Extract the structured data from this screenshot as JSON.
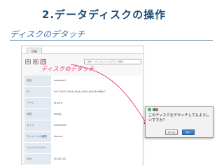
{
  "slide": {
    "title": "2.データディスクの操作",
    "subtitle": "ディスクのデタッチ"
  },
  "panel": {
    "tab_label": "詳細",
    "toolbar": {
      "action_select_text": "操作・ステップレスバックアップ操作",
      "buttons": [
        {
          "icon": "attach-icon",
          "glyph": "⊞"
        },
        {
          "icon": "snapshot-icon",
          "glyph": "▤"
        },
        {
          "icon": "detach-icon",
          "glyph": "⊟"
        }
      ]
    },
    "callout": "ディスクのデタッチ",
    "rows": [
      {
        "label": "名前",
        "value": "datadisk1"
      },
      {
        "label": "ID",
        "value": "ec013c50-20a6-45ab-a054-8b5f40a88b7"
      },
      {
        "label": "ゾーン",
        "value": "jp-w1a"
      },
      {
        "label": "状態",
        "value": "Ready"
      },
      {
        "label": "タイプ",
        "value": "DATADISK"
      },
      {
        "label": "ストレージの種類",
        "value": "shared"
      },
      {
        "label": "ハイパーバイザー",
        "value": ""
      },
      {
        "label": "Size",
        "value": "40.00 GB"
      }
    ]
  },
  "dialog": {
    "title": "確認",
    "message": "このディスクをデタッチしてもよろしいですか?",
    "no_label": "いいえ",
    "yes_label": "はい"
  },
  "colors": {
    "title": "#1f4e79",
    "accent": "#e0206a",
    "label_bg": "#e3e9f1",
    "primary_button": "#2d6db3"
  }
}
